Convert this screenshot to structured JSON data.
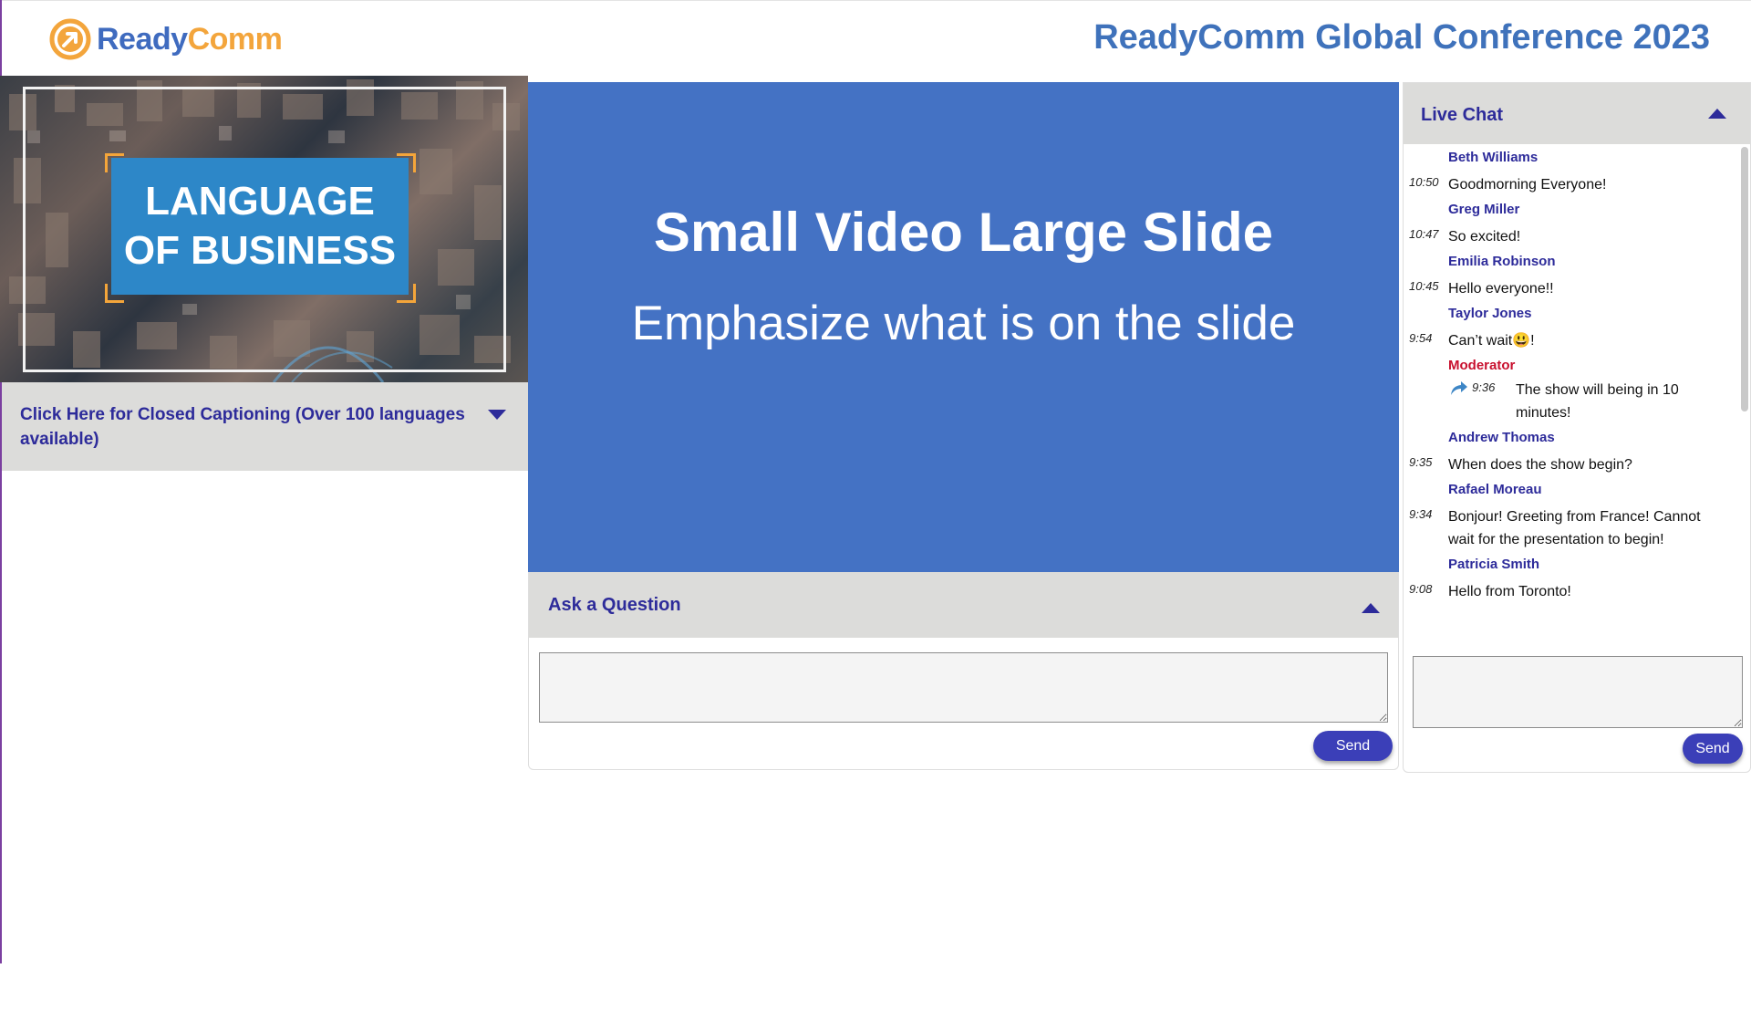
{
  "brand": {
    "logo_ready": "Ready",
    "logo_comm": "Comm"
  },
  "header": {
    "title": "ReadyComm Global Conference 2023"
  },
  "video": {
    "title_line1": "LANGUAGE",
    "title_line2": "OF BUSINESS"
  },
  "captions": {
    "label": "Click Here for Closed Captioning (Over 100 languages available)"
  },
  "slide": {
    "title": "Small Video Large Slide",
    "subtitle": "Emphasize what is on the slide"
  },
  "ask": {
    "title": "Ask a Question",
    "input_value": "",
    "send_label": "Send"
  },
  "chat": {
    "title": "Live Chat",
    "input_value": "",
    "send_label": "Send",
    "messages": [
      {
        "name": "Beth Williams",
        "time": "10:50",
        "text": "Goodmorning Everyone!"
      },
      {
        "name": "Greg Miller",
        "time": "10:47",
        "text": "So excited!"
      },
      {
        "name": "Emilia Robinson",
        "time": "10:45",
        "text": "Hello everyone!!"
      },
      {
        "name": "Taylor Jones",
        "time": "9:54",
        "text": "Can’t wait😃!"
      },
      {
        "name": "Moderator",
        "time": "9:36",
        "text": "The show will being in 10 minutes!"
      },
      {
        "name": "Andrew Thomas",
        "time": "9:35",
        "text": "When does the show begin?"
      },
      {
        "name": "Rafael Moreau",
        "time": "9:34",
        "text": "Bonjour! Greeting from France! Cannot wait for the presentation to begin!"
      },
      {
        "name": "Patricia Smith",
        "time": "9:08",
        "text": "Hello from Toronto!"
      }
    ]
  },
  "colors": {
    "brand_blue": "#3f72bb",
    "brand_orange": "#f3a53c",
    "slide_bg": "#4472c4",
    "accent_navy": "#2d2b9a",
    "moderator_red": "#c8102e"
  }
}
